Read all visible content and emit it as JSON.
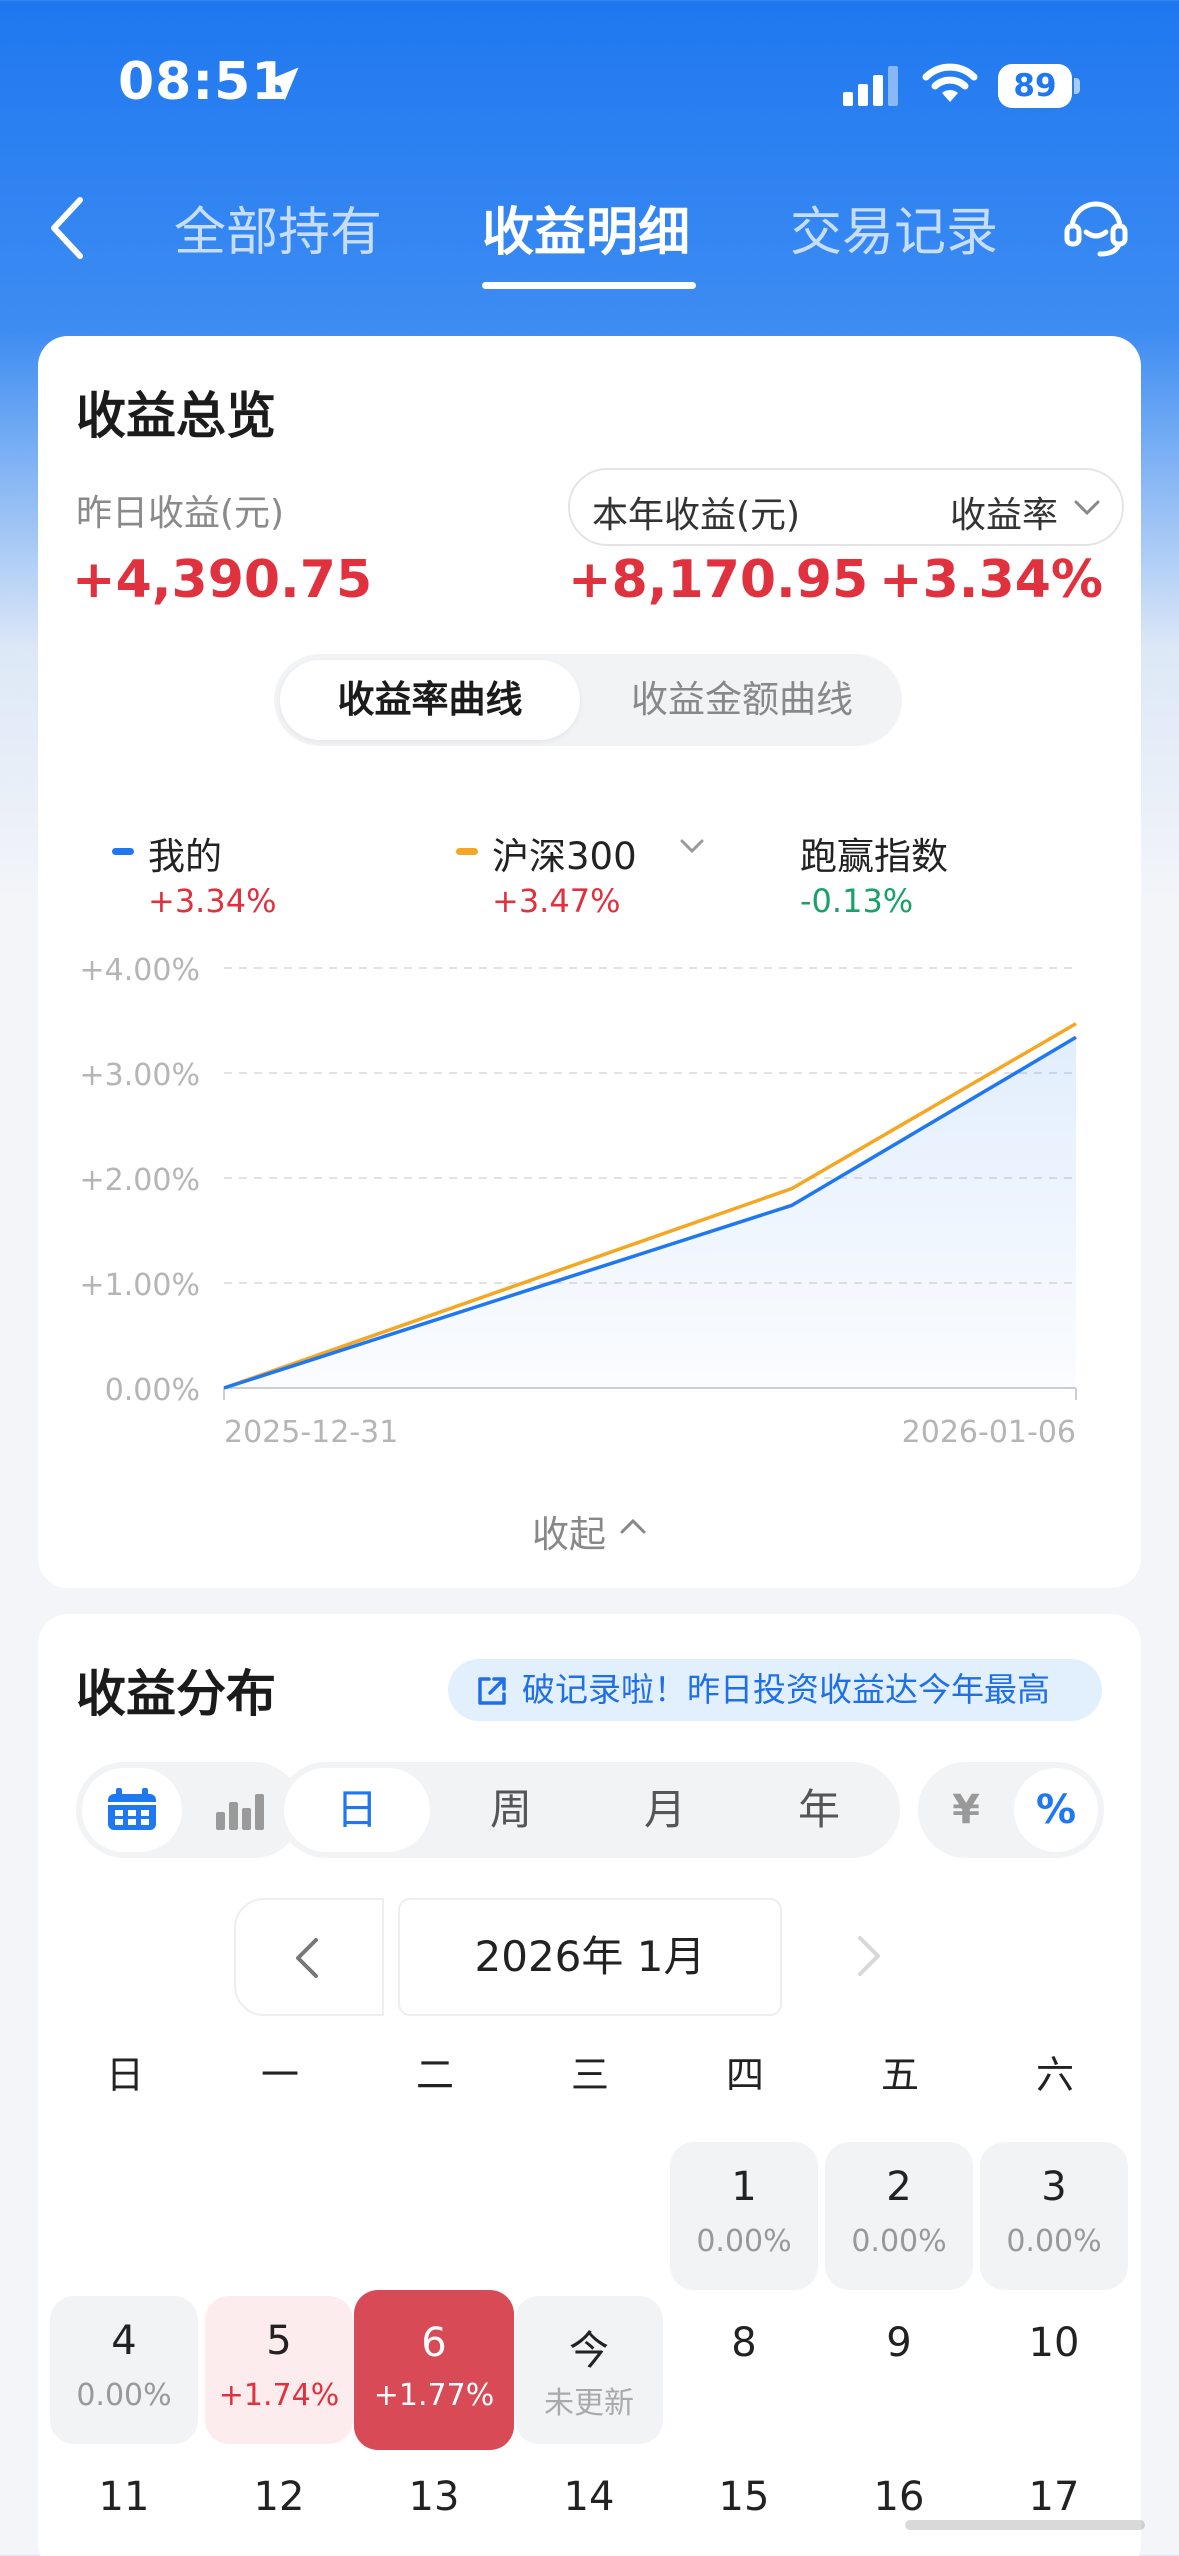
{
  "status_bar": {
    "time": "08:51",
    "battery": "89"
  },
  "nav": {
    "tabs": [
      {
        "label": "全部持有",
        "active": false
      },
      {
        "label": "收益明细",
        "active": true
      },
      {
        "label": "交易记录",
        "active": false
      }
    ]
  },
  "overview": {
    "title": "收益总览",
    "yesterday_label": "昨日收益(元)",
    "yesterday_value": "+4,390.75",
    "year_label": "本年收益(元)",
    "year_value": "+8,170.95",
    "rate_label": "收益率",
    "rate_value": "+3.34%",
    "curve_tabs": [
      "收益率曲线",
      "收益金额曲线"
    ],
    "legend": [
      {
        "name": "我的",
        "value": "+3.34%",
        "color": "#1f78f0",
        "value_color": "#e0313f"
      },
      {
        "name": "沪深300",
        "value": "+3.47%",
        "color": "#f5a623",
        "value_color": "#e0313f"
      },
      {
        "name": "跑赢指数",
        "value": "-0.13%",
        "color": "",
        "value_color": "#1aa06a"
      }
    ],
    "collapse_label": "收起"
  },
  "chart_data": {
    "type": "line",
    "x": [
      "2025-12-31",
      "2026-01-05",
      "2026-01-06"
    ],
    "x_tick_labels": [
      "2025-12-31",
      "2026-01-06"
    ],
    "y_tick_labels": [
      "+4.00%",
      "+3.00%",
      "+2.00%",
      "+1.00%",
      "0.00%"
    ],
    "ylim": [
      0,
      4
    ],
    "grid": true,
    "series": [
      {
        "name": "我的",
        "color": "#1f78f0",
        "fill": true,
        "values": [
          0.0,
          1.74,
          3.34
        ]
      },
      {
        "name": "沪深300",
        "color": "#f5a623",
        "fill": false,
        "values": [
          0.0,
          1.9,
          3.47
        ]
      }
    ]
  },
  "distribution": {
    "title": "收益分布",
    "banner": "破记录啦！昨日投资收益达今年最高",
    "periods": [
      "日",
      "周",
      "月",
      "年"
    ],
    "active_period": "日",
    "units": [
      "¥",
      "%"
    ],
    "month_label": "2026年 1月",
    "weekdays": [
      "日",
      "一",
      "二",
      "三",
      "四",
      "五",
      "六"
    ],
    "days": [
      {
        "num": "1",
        "pct": "0.00%"
      },
      {
        "num": "2",
        "pct": "0.00%"
      },
      {
        "num": "3",
        "pct": "0.00%"
      },
      {
        "num": "4",
        "pct": "0.00%"
      },
      {
        "num": "5",
        "pct": "+1.74%"
      },
      {
        "num": "6",
        "pct": "+1.77%"
      },
      {
        "num": "今",
        "pct": "未更新"
      },
      {
        "num": "8"
      },
      {
        "num": "9"
      },
      {
        "num": "10"
      },
      {
        "num": "11"
      },
      {
        "num": "12"
      },
      {
        "num": "13"
      },
      {
        "num": "14"
      },
      {
        "num": "15"
      },
      {
        "num": "16"
      },
      {
        "num": "17"
      }
    ]
  }
}
